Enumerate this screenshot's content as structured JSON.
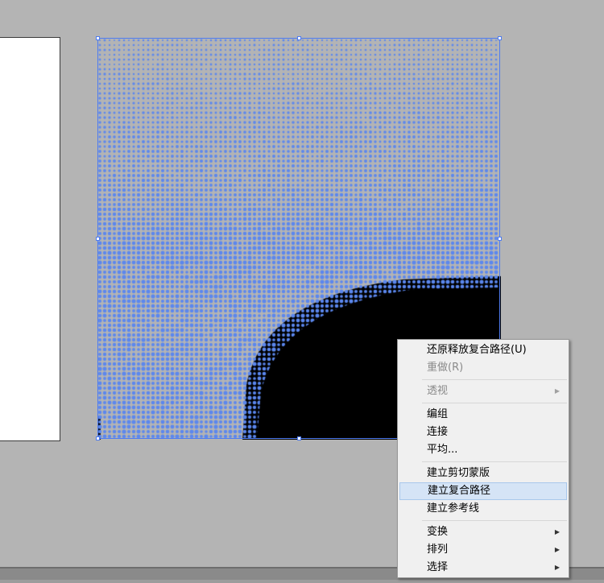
{
  "colors": {
    "workspace": "#b4b4b4",
    "dot_blue": "#5b87ee",
    "selection": "#4f7cf0",
    "fill_black": "#000000",
    "menu_bg": "#f0f0f0",
    "menu_highlight": "#d5e4f6"
  },
  "context_menu": {
    "items": [
      {
        "id": "undo-release-compound-path",
        "label": "还原释放复合路径(U)",
        "enabled": true
      },
      {
        "id": "redo",
        "label": "重做(R)",
        "enabled": false
      },
      {
        "id": "perspective",
        "label": "透视",
        "enabled": false,
        "submenu": true
      },
      {
        "id": "group",
        "label": "编组",
        "enabled": true
      },
      {
        "id": "join",
        "label": "连接",
        "enabled": true
      },
      {
        "id": "average",
        "label": "平均...",
        "enabled": true
      },
      {
        "id": "make-clipping-mask",
        "label": "建立剪切蒙版",
        "enabled": true
      },
      {
        "id": "make-compound-path",
        "label": "建立复合路径",
        "enabled": true,
        "highlighted": true
      },
      {
        "id": "make-guides",
        "label": "建立参考线",
        "enabled": true
      },
      {
        "id": "transform",
        "label": "变换",
        "enabled": true,
        "submenu": true
      },
      {
        "id": "arrange",
        "label": "排列",
        "enabled": true,
        "submenu": true
      },
      {
        "id": "select",
        "label": "选择",
        "enabled": true,
        "submenu": true
      }
    ],
    "submenu_arrow_icon": "triangle-right-icon"
  }
}
